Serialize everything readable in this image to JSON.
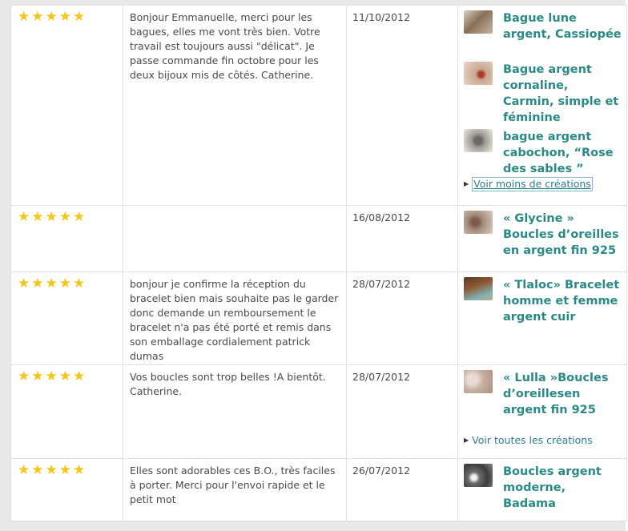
{
  "reviews": [
    {
      "stars": 5,
      "text": "Bonjour Emmanuelle, merci pour les bagues, elles me vont très bien. Votre travail est toujours aussi \"délicat\". Je passe commande fin octobre pour les deux bijoux mis de côtés. Catherine.",
      "date": "11/10/2012",
      "products": [
        {
          "title": "Bague lune argent, Cassiopée",
          "thumb_color": "#8a6f55"
        },
        {
          "title": "Bague argent cornaline, Carmin, simple et féminine",
          "thumb_color": "#c9a58f"
        },
        {
          "title": "bague argent cabochon, “Rose des sables ”",
          "thumb_color": "#9c9890"
        }
      ],
      "more_link": "Voir moins de créations"
    },
    {
      "stars": 5,
      "text": "",
      "date": "16/08/2012",
      "products": [
        {
          "title": "« Glycine » Boucles d’oreilles en argent fin 925",
          "thumb_color": "#a88e7d"
        }
      ]
    },
    {
      "stars": 5,
      "text": "bonjour je confirme la réception du bracelet bien mais souhaite pas le garder donc demande un remboursement le bracelet n'a pas été porté et remis dans son emballage cordialement patrick dumas",
      "date": "28/07/2012",
      "products": [
        {
          "title": "« Tlaloc» Bracelet homme et femme argent cuir",
          "thumb_color": "#8f5a35"
        }
      ]
    },
    {
      "stars": 5,
      "text": "Vos boucles sont trop belles !A bientôt. Catherine.",
      "date": "28/07/2012",
      "products": [
        {
          "title": "« Lulla »Boucles d’oreillesen argent fin 925",
          "thumb_color": "#c7b0a2"
        }
      ],
      "more_link": "Voir toutes les créations"
    },
    {
      "stars": 5,
      "text": "Elles sont adorables ces B.O., très faciles à porter. Merci pour l'envoi rapide et le petit mot",
      "date": "26/07/2012",
      "products": [
        {
          "title": "Boucles argent moderne, Badama",
          "thumb_color": "#6d6b69"
        }
      ]
    }
  ],
  "colors": {
    "star": "#f5c518",
    "product_link": "#2a8a87",
    "text": "#4a4a4a"
  }
}
